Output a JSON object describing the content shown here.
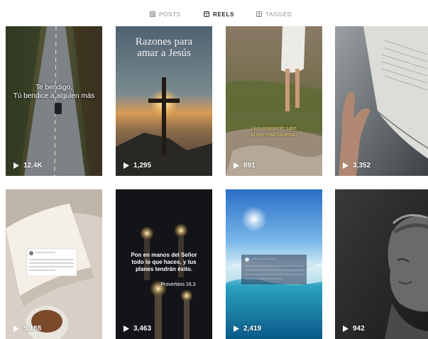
{
  "tabs": [
    {
      "label": "POSTS",
      "icon": "grid-icon",
      "active": false
    },
    {
      "label": "REELS",
      "icon": "reels-icon",
      "active": true
    },
    {
      "label": "TAGGED",
      "icon": "tagged-icon",
      "active": false
    }
  ],
  "reels": [
    {
      "views": "12.4K",
      "overlay": [
        "Te bendigo.",
        "Tú bendice a alguien más"
      ]
    },
    {
      "views": "1,295",
      "overlay": [
        "Razones para",
        "amar a Jesús"
      ]
    },
    {
      "views": "891",
      "overlay": [
        "Dios realmente sabe",
        "lo que está haciendo"
      ]
    },
    {
      "views": "3,352"
    },
    {
      "views": "5,188"
    },
    {
      "views": "3,463",
      "overlay": [
        "Pon en manos del Señor",
        "todo lo que haces, y tus",
        "planes tendrán éxito."
      ],
      "reference": "Proverbios 16,3"
    },
    {
      "views": "2,419"
    },
    {
      "views": "942"
    }
  ]
}
